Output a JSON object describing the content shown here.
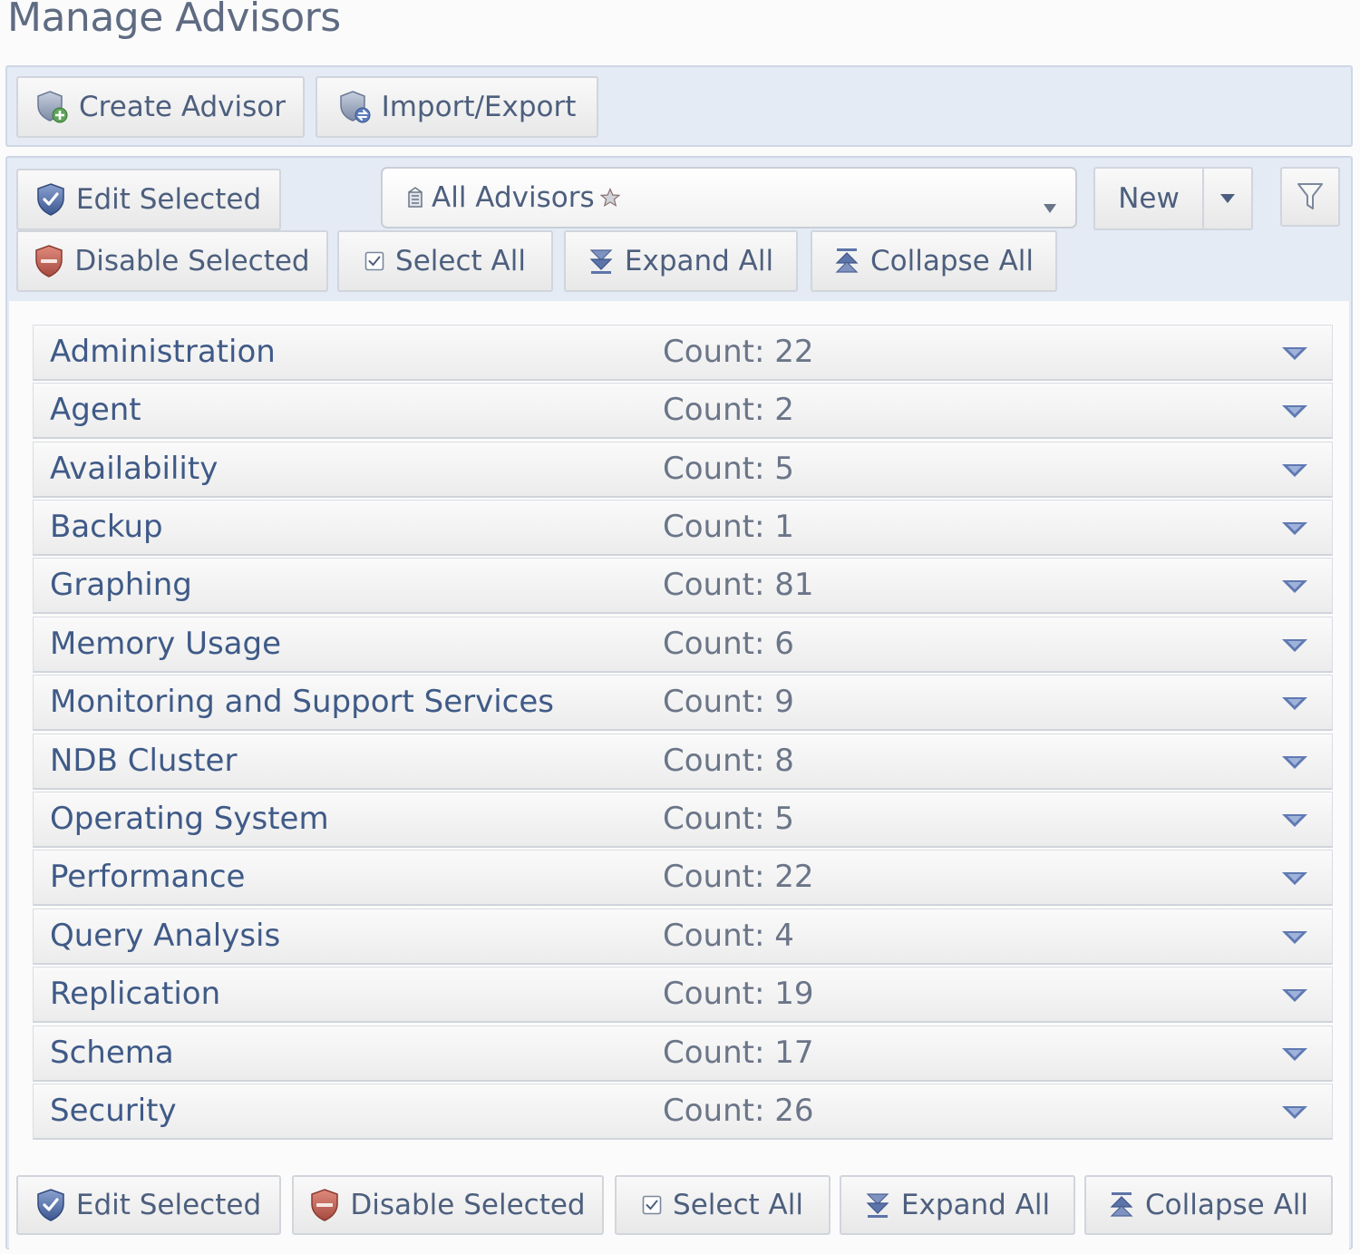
{
  "page": {
    "title": "Manage Advisors"
  },
  "top_toolbar": {
    "create_advisor": "Create Advisor",
    "import_export": "Import/Export"
  },
  "toolbar": {
    "edit_selected": "Edit Selected",
    "disable_selected": "Disable Selected",
    "select_all": "Select All",
    "expand_all": "Expand All",
    "collapse_all": "Collapse All",
    "filter_select": {
      "selected": "All Advisors"
    },
    "new_button": "New"
  },
  "categories": [
    {
      "name": "Administration",
      "count": "Count: 22"
    },
    {
      "name": "Agent",
      "count": "Count: 2"
    },
    {
      "name": "Availability",
      "count": "Count: 5"
    },
    {
      "name": "Backup",
      "count": "Count: 1"
    },
    {
      "name": "Graphing",
      "count": "Count: 81"
    },
    {
      "name": "Memory Usage",
      "count": "Count: 6"
    },
    {
      "name": "Monitoring and Support Services",
      "count": "Count: 9"
    },
    {
      "name": "NDB Cluster",
      "count": "Count: 8"
    },
    {
      "name": "Operating System",
      "count": "Count: 5"
    },
    {
      "name": "Performance",
      "count": "Count: 22"
    },
    {
      "name": "Query Analysis",
      "count": "Count: 4"
    },
    {
      "name": "Replication",
      "count": "Count: 19"
    },
    {
      "name": "Schema",
      "count": "Count: 17"
    },
    {
      "name": "Security",
      "count": "Count: 26"
    }
  ],
  "bottom_toolbar": {
    "edit_selected": "Edit Selected",
    "disable_selected": "Disable Selected",
    "select_all": "Select All",
    "expand_all": "Expand All",
    "collapse_all": "Collapse All"
  },
  "icons": {
    "shield_edit": "shield-check-icon",
    "shield_disable": "shield-minus-icon",
    "create": "shield-plus-icon",
    "import_export": "shield-arrows-icon",
    "select_all": "checkbox-icon",
    "expand": "double-chevron-down-icon",
    "collapse": "double-chevron-up-icon",
    "filter": "funnel-icon",
    "row_toggle": "chevron-down-icon"
  },
  "colors": {
    "accent_blue": "#5b74a8",
    "disable_red": "#b86060",
    "panel_bg": "#e4ebf5",
    "link_text": "#3f5a87"
  }
}
